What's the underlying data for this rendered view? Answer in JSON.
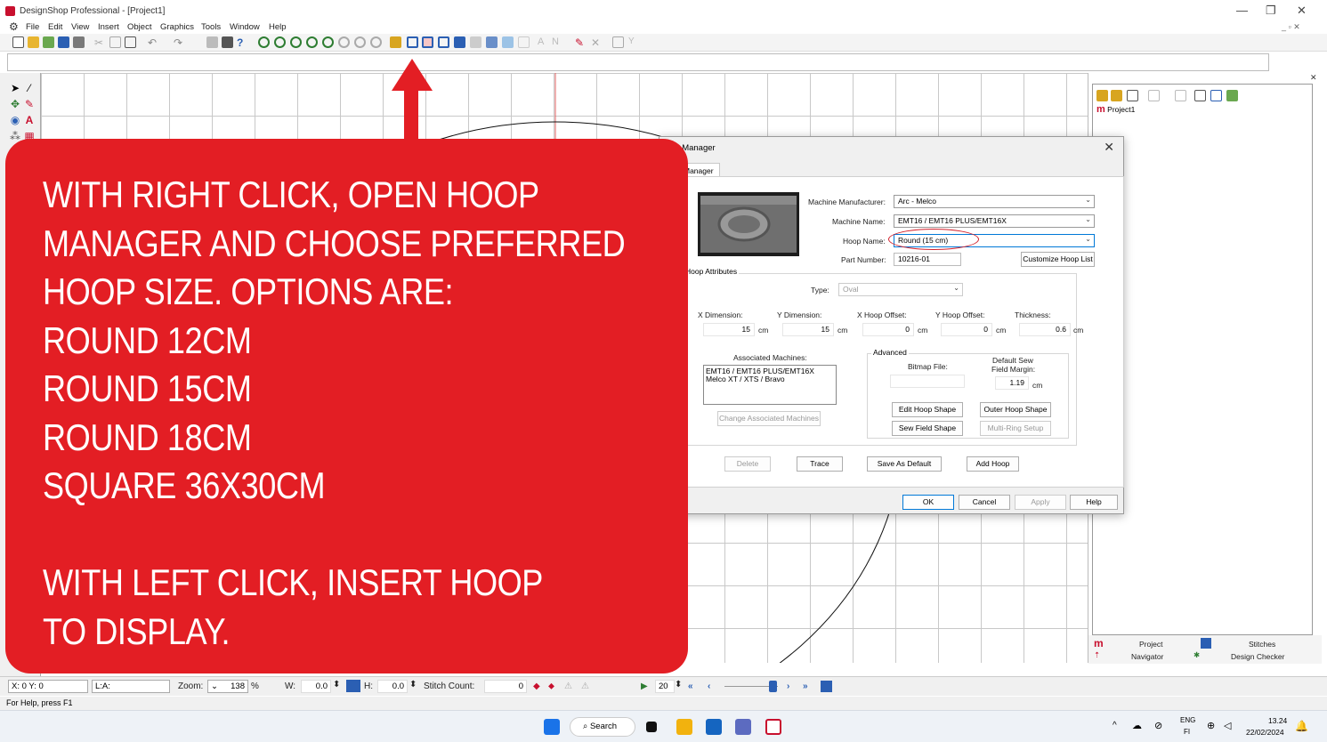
{
  "window": {
    "title": "DesignShop Professional - [Project1]",
    "controls": [
      "—",
      "❐",
      "✕"
    ]
  },
  "menu": {
    "items": [
      "File",
      "Edit",
      "View",
      "Insert",
      "Object",
      "Graphics",
      "Tools",
      "Window",
      "Help"
    ],
    "mdi_controls": "_ ▫ ✕"
  },
  "overlay": {
    "lines": [
      "WITH RIGHT CLICK, OPEN HOOP",
      "MANAGER AND CHOOSE PREFERRED",
      "HOOP SIZE. OPTIONS ARE:",
      "ROUND 12CM",
      "ROUND 15CM",
      "ROUND 18CM",
      "SQUARE 36X30CM",
      "",
      "WITH LEFT CLICK, INSERT HOOP",
      "TO DISPLAY."
    ],
    "color": "#e31e24"
  },
  "dialog": {
    "title": "Hoop Manager",
    "title_visible": "op Manager",
    "tab_visible": "Manager",
    "manufacturer_label": "Machine Manufacturer:",
    "manufacturer_value": "Arc - Melco",
    "machine_label": "Machine Name:",
    "machine_value": "EMT16 / EMT16 PLUS/EMT16X",
    "hoop_label": "Hoop Name:",
    "hoop_value": "Round (15 cm)",
    "part_label": "Part Number:",
    "part_value": "10216-01",
    "customize_button": "Customize Hoop List",
    "attributes_group": "Hoop Attributes",
    "type_label": "Type:",
    "type_value": "Oval",
    "xdim_label": "X Dimension:",
    "xdim_value": "15",
    "ydim_label": "Y Dimension:",
    "ydim_value": "15",
    "xoff_label": "X Hoop Offset:",
    "xoff_value": "0",
    "yoff_label": "Y Hoop Offset:",
    "yoff_value": "0",
    "thick_label": "Thickness:",
    "thick_value": "0.6",
    "unit": "cm",
    "assoc_label": "Associated Machines:",
    "assoc_items": [
      "EMT16 / EMT16 PLUS/EMT16X",
      "Melco XT / XTS / Bravo"
    ],
    "change_assoc_button": "Change Associated Machines",
    "advanced_group": "Advanced",
    "bitmap_label": "Bitmap File:",
    "margin_label_1": "Default Sew",
    "margin_label_2": "Field Margin:",
    "margin_value": "1.19",
    "edit_shape_button": "Edit Hoop Shape",
    "outer_shape_button": "Outer Hoop Shape",
    "sew_field_button": "Sew Field Shape",
    "multi_ring_button": "Multi-Ring Setup",
    "delete_button": "Delete",
    "trace_button": "Trace",
    "save_default_button": "Save As Default",
    "add_hoop_button": "Add Hoop",
    "ok_button": "OK",
    "cancel_button": "Cancel",
    "apply_button": "Apply",
    "help_button": "Help"
  },
  "right_panel": {
    "tree_root": "Project1",
    "tabs": [
      "Project",
      "Stitches",
      "Navigator",
      "Design Checker"
    ]
  },
  "bottom": {
    "coords": "X: 0 Y: 0",
    "la": "L:A:",
    "zoom_label": "Zoom:",
    "zoom_value": "138",
    "zoom_unit": "%",
    "w_label": "W:",
    "w_value": "0.0",
    "h_label": "H:",
    "h_value": "0.0",
    "stitch_label": "Stitch Count:",
    "stitch_value": "0",
    "speed_value": "20"
  },
  "status": {
    "text": "For Help, press F1"
  },
  "taskbar": {
    "search": "Search",
    "lang_1": "ENG",
    "lang_2": "FI",
    "time": "13.24",
    "date": "22/02/2024"
  }
}
